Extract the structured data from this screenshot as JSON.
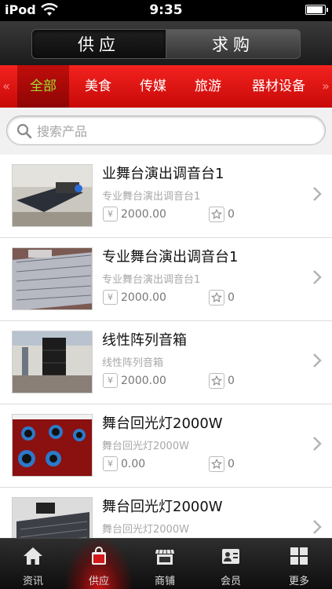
{
  "status_bar": {
    "carrier": "iPod",
    "time": "9:35"
  },
  "header": {
    "tabs": [
      {
        "label": "供应",
        "selected": true
      },
      {
        "label": "求购",
        "selected": false
      }
    ]
  },
  "categories": {
    "items": [
      "全部",
      "美食",
      "传媒",
      "旅游",
      "器材设备"
    ],
    "active_index": 0,
    "active_color": "#9adf33"
  },
  "search": {
    "placeholder": "搜索产品"
  },
  "products": [
    {
      "title": "业舞台演出调音台1",
      "subtitle": "专业舞台演出调音台1",
      "price_symbol": "¥",
      "price": "2000.00",
      "favorites": "0"
    },
    {
      "title": "专业舞台演出调音台1",
      "subtitle": "专业舞台演出调音台1",
      "price_symbol": "¥",
      "price": "2000.00",
      "favorites": "0"
    },
    {
      "title": "线性阵列音箱",
      "subtitle": "线性阵列音箱",
      "price_symbol": "¥",
      "price": "2000.00",
      "favorites": "0"
    },
    {
      "title": "舞台回光灯2000W",
      "subtitle": "舞台回光灯2000W",
      "price_symbol": "¥",
      "price": "0.00",
      "favorites": "0"
    },
    {
      "title": "舞台回光灯2000W",
      "subtitle": "舞台回光灯2000W",
      "price_symbol": "¥",
      "price": "",
      "favorites": ""
    }
  ],
  "bottom_nav": {
    "items": [
      {
        "label": "资讯",
        "icon": "home-icon"
      },
      {
        "label": "供应",
        "icon": "bag-icon"
      },
      {
        "label": "商铺",
        "icon": "shop-icon"
      },
      {
        "label": "会员",
        "icon": "member-card-icon"
      },
      {
        "label": "更多",
        "icon": "grid-icon"
      }
    ],
    "active_index": 1
  },
  "colors": {
    "brand_red": "#e0100e",
    "active_tab_text": "#9adf33"
  }
}
